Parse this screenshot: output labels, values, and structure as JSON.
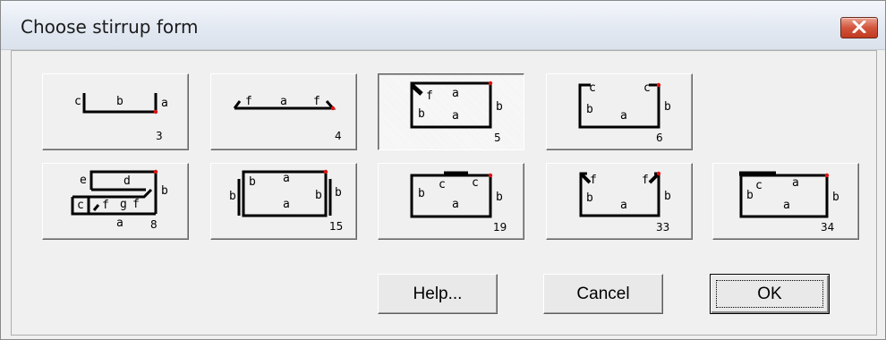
{
  "window": {
    "title": "Choose stirrup form",
    "close_icon": "close-icon"
  },
  "shapes": [
    {
      "id": 3,
      "number": "3",
      "labels": [
        "c",
        "b",
        "a"
      ],
      "selected": false
    },
    {
      "id": 4,
      "number": "4",
      "labels": [
        "f",
        "a",
        "f"
      ],
      "selected": false
    },
    {
      "id": 5,
      "number": "5",
      "labels": [
        "f",
        "a",
        "b",
        "a",
        "b"
      ],
      "selected": true
    },
    {
      "id": 6,
      "number": "6",
      "labels": [
        "c",
        "c",
        "b",
        "a",
        "b"
      ],
      "selected": false
    },
    {
      "id": 8,
      "number": "8",
      "labels": [
        "e",
        "d",
        "b",
        "c",
        "f",
        "g",
        "f",
        "a"
      ],
      "selected": false
    },
    {
      "id": 15,
      "number": "15",
      "labels": [
        "b",
        "b",
        "a",
        "b",
        "a",
        "b"
      ],
      "selected": false
    },
    {
      "id": 19,
      "number": "19",
      "labels": [
        "c",
        "c",
        "b",
        "a",
        "b"
      ],
      "selected": false
    },
    {
      "id": 33,
      "number": "33",
      "labels": [
        "f",
        "f",
        "b",
        "a",
        "b"
      ],
      "selected": false
    },
    {
      "id": 34,
      "number": "34",
      "labels": [
        "c",
        "a",
        "b",
        "a",
        "b"
      ],
      "selected": false
    }
  ],
  "buttons": {
    "help": "Help...",
    "cancel": "Cancel",
    "ok": "OK"
  },
  "colors": {
    "endpoint_marker": "#e01010",
    "shape_stroke": "#000000",
    "close_button": "#c9452b"
  }
}
